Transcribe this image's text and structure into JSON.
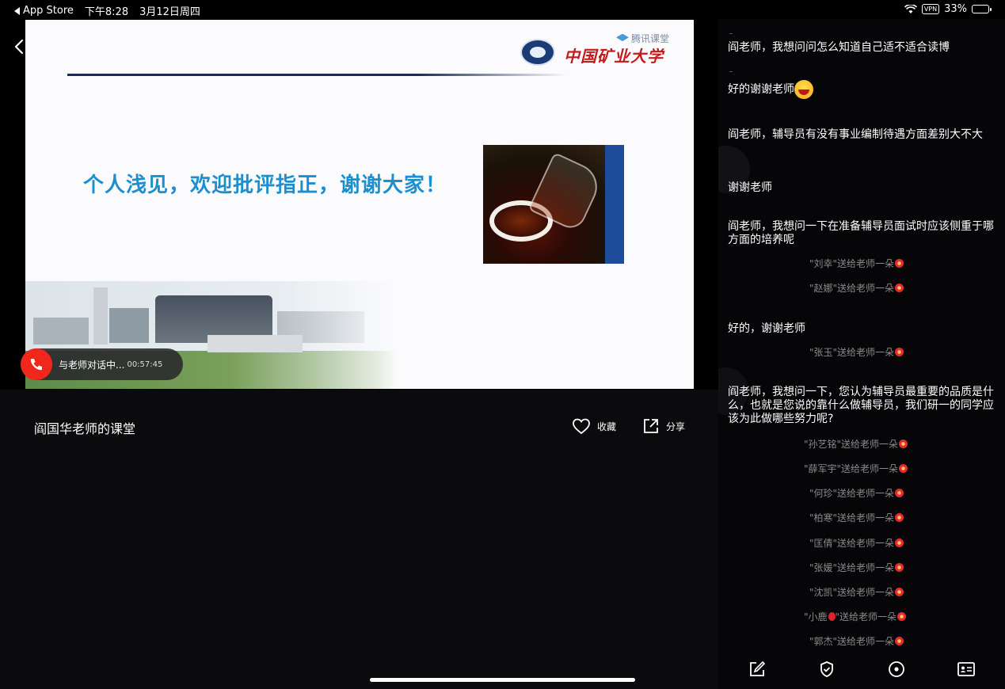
{
  "status_bar": {
    "back_app": "App Store",
    "time": "下午8:28",
    "date": "3月12日周四",
    "vpn": "VPN",
    "battery": "33%",
    "battery_level": 0.33
  },
  "slide": {
    "university_name": "中国矿业大学",
    "watermark": "腾讯课堂",
    "headline": "个人浅见，欢迎批评指正，谢谢大家！"
  },
  "call": {
    "status": "与老师对话中...",
    "duration": "00:57:45"
  },
  "course": {
    "title": "阎国华老师的课堂",
    "favorite_label": "收藏",
    "share_label": "分享"
  },
  "chat": {
    "messages": [
      {
        "text": "阎老师，我想问问怎么知道自己适不适合读博"
      },
      {
        "text": "好的谢谢老师"
      },
      {
        "text": "阎老师，辅导员有没有事业编制待遇方面差别大不大"
      },
      {
        "text": "谢谢老师"
      },
      {
        "text": "阎老师，我想问一下在准备辅导员面试时应该侧重于哪方面的培养呢"
      },
      {
        "text": "好的，谢谢老师"
      },
      {
        "text": "阎老师，我想问一下，您认为辅导员最重要的品质是什么，也就是您说的靠什么做辅导员，我们研一的同学应该为此做哪些努力呢?"
      }
    ],
    "gifts": [
      {
        "text": "\"刘幸\"送给老师一朵"
      },
      {
        "text": "\"赵娜\"送给老师一朵"
      },
      {
        "text": "\"张玉\"送给老师一朵"
      },
      {
        "text": "\"孙艺铭\"送给老师一朵"
      },
      {
        "text": "\"薛军宇\"送给老师一朵"
      },
      {
        "text": "\"何珍\"送给老师一朵"
      },
      {
        "text": "\"柏寒\"送给老师一朵"
      },
      {
        "text": "\"匡倩\"送给老师一朵"
      },
      {
        "text": "\"张媛\"送给老师一朵"
      },
      {
        "text": "\"沈凯\"送给老师一朵"
      },
      {
        "text_a": "\"小鹿",
        "text_b": "\"送给老师一朵"
      },
      {
        "text": "\"郭杰\"送给老师一朵"
      }
    ]
  },
  "toolbar": {
    "icons": [
      "edit-icon",
      "shield-icon",
      "target-icon",
      "id-card-icon"
    ]
  }
}
